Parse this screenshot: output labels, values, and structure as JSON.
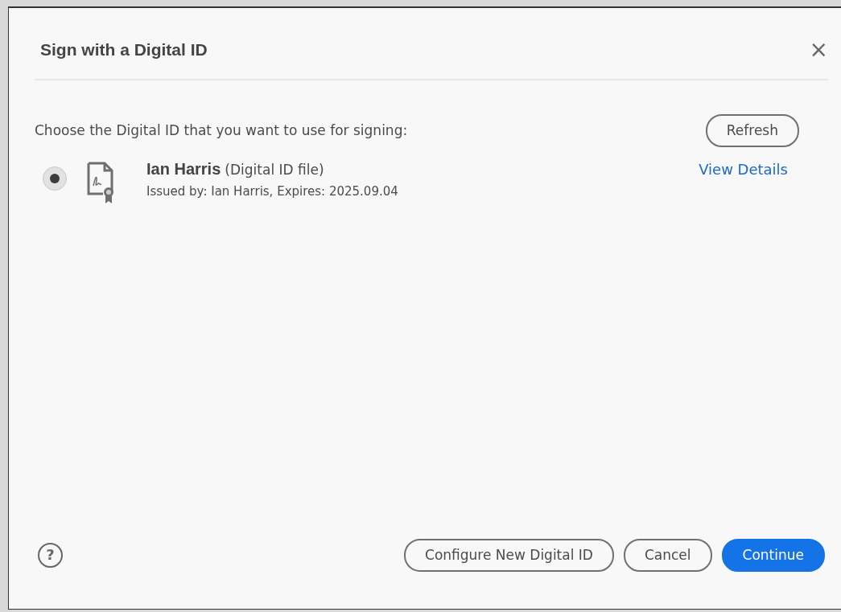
{
  "dialog": {
    "title": "Sign with a Digital ID",
    "close": "×"
  },
  "prompt": "Choose the Digital ID that you want to use for signing:",
  "refresh_button": "Refresh",
  "ids": [
    {
      "name": "Ian Harris",
      "type": "(Digital ID file)",
      "details": "Issued by: Ian Harris, Expires: 2025.09.04",
      "link": "View Details",
      "selected": true
    }
  ],
  "help": "?",
  "buttons": [
    {
      "label": "Configure New Digital ID",
      "kind": "outline"
    },
    {
      "label": "Cancel",
      "kind": "outline"
    },
    {
      "label": "Continue",
      "kind": "primary"
    }
  ]
}
